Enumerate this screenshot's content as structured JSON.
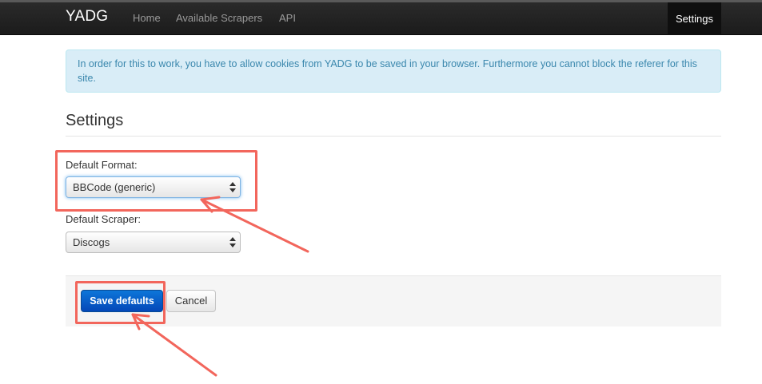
{
  "navbar": {
    "brand": "YADG",
    "links": [
      "Home",
      "Available Scrapers",
      "API"
    ],
    "settings": "Settings"
  },
  "alert": {
    "text": "In order for this to work, you have to allow cookies from YADG to be saved in your browser. Furthermore you cannot block the referer for this site."
  },
  "page": {
    "title": "Settings"
  },
  "form": {
    "format_label": "Default Format:",
    "format_value": "BBCode (generic)",
    "scraper_label": "Default Scraper:",
    "scraper_value": "Discogs",
    "save_label": "Save defaults",
    "cancel_label": "Cancel"
  },
  "colors": {
    "annotation": "#f2665c",
    "primary": "#0447b8",
    "alert_bg": "#d9edf7",
    "alert_text": "#3a87ad"
  }
}
